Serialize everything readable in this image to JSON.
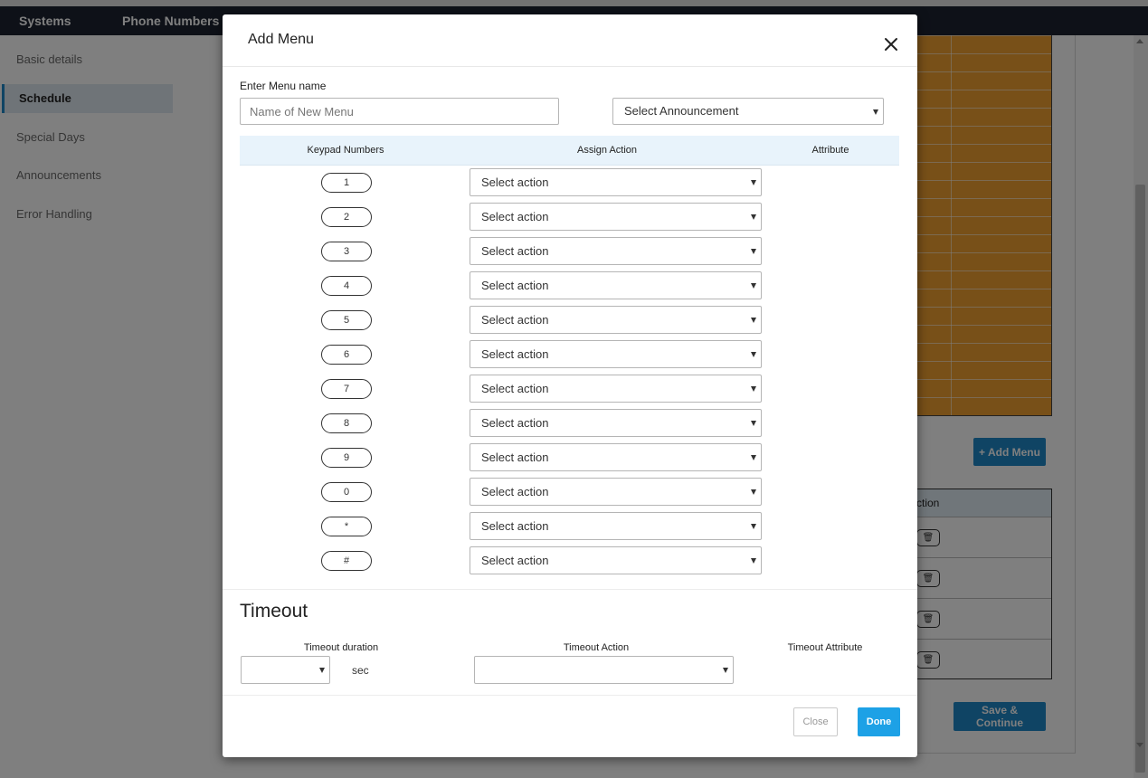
{
  "topnav": {
    "items": [
      "Systems",
      "Phone Numbers"
    ]
  },
  "sidebar": {
    "items": [
      {
        "label": "Basic details",
        "active": false
      },
      {
        "label": "Schedule",
        "active": true
      },
      {
        "label": "Special Days",
        "active": false
      },
      {
        "label": "Announcements",
        "active": false
      },
      {
        "label": "Error Handling",
        "active": false
      }
    ]
  },
  "background": {
    "add_menu_label": "+ Add Menu",
    "table_header": "ction",
    "save_continue_label": "Save & Continue",
    "grid_color": "#f0a030"
  },
  "modal": {
    "title": "Add Menu",
    "menu_name_label": "Enter Menu name",
    "menu_name_placeholder": "Name of New Menu",
    "menu_name_value": "",
    "announcement_select": "Select Announcement",
    "table": {
      "headers": [
        "Keypad Numbers",
        "Assign Action",
        "Attribute"
      ],
      "rows": [
        {
          "key": "1",
          "action": "Select action"
        },
        {
          "key": "2",
          "action": "Select action"
        },
        {
          "key": "3",
          "action": "Select action"
        },
        {
          "key": "4",
          "action": "Select action"
        },
        {
          "key": "5",
          "action": "Select action"
        },
        {
          "key": "6",
          "action": "Select action"
        },
        {
          "key": "7",
          "action": "Select action"
        },
        {
          "key": "8",
          "action": "Select action"
        },
        {
          "key": "9",
          "action": "Select action"
        },
        {
          "key": "0",
          "action": "Select action"
        },
        {
          "key": "*",
          "action": "Select action"
        },
        {
          "key": "#",
          "action": "Select action"
        }
      ]
    },
    "timeout": {
      "title": "Timeout",
      "duration_label": "Timeout duration",
      "duration_value": "",
      "unit": "sec",
      "action_label": "Timeout Action",
      "action_value": "",
      "attribute_label": "Timeout Attribute"
    },
    "buttons": {
      "close": "Close",
      "done": "Done"
    },
    "accent_color": "#1da1e6"
  }
}
